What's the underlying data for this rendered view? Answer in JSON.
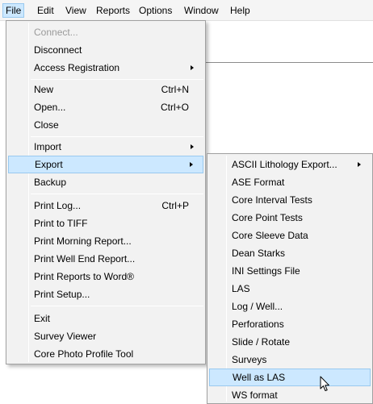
{
  "menubar": {
    "items": [
      "File",
      "Edit",
      "View",
      "Reports",
      "Options",
      "Window",
      "Help"
    ]
  },
  "file_menu": {
    "items": [
      {
        "label": "Connect...",
        "disabled": true
      },
      {
        "label": "Disconnect"
      },
      {
        "label": "Access Registration",
        "submenu": true
      },
      {
        "label": "New",
        "shortcut": "Ctrl+N"
      },
      {
        "label": "Open...",
        "shortcut": "Ctrl+O"
      },
      {
        "label": "Close"
      },
      {
        "label": "Import",
        "submenu": true
      },
      {
        "label": "Export",
        "submenu": true,
        "highlighted": true
      },
      {
        "label": "Backup"
      },
      {
        "label": "Print Log...",
        "shortcut": "Ctrl+P"
      },
      {
        "label": "Print to TIFF"
      },
      {
        "label": "Print Morning Report..."
      },
      {
        "label": "Print Well End Report..."
      },
      {
        "label": "Print Reports to Word®"
      },
      {
        "label": "Print Setup..."
      },
      {
        "label": "Exit"
      },
      {
        "label": "Survey Viewer"
      },
      {
        "label": "Core Photo Profile Tool"
      }
    ]
  },
  "export_menu": {
    "items": [
      {
        "label": "ASCII Lithology Export...",
        "submenu": true
      },
      {
        "label": "ASE Format"
      },
      {
        "label": "Core Interval Tests"
      },
      {
        "label": "Core Point Tests"
      },
      {
        "label": "Core Sleeve Data"
      },
      {
        "label": "Dean Starks"
      },
      {
        "label": "INI Settings File"
      },
      {
        "label": "LAS"
      },
      {
        "label": "Log / Well..."
      },
      {
        "label": "Perforations"
      },
      {
        "label": "Slide / Rotate"
      },
      {
        "label": "Surveys"
      },
      {
        "label": "Well as LAS",
        "highlighted": true
      },
      {
        "label": "WS format"
      }
    ]
  },
  "colors": {
    "menu_bg": "#f2f2f2",
    "highlight": "#cce8ff",
    "highlight_border": "#99c9ef",
    "disabled_text": "#9a9a9a"
  }
}
